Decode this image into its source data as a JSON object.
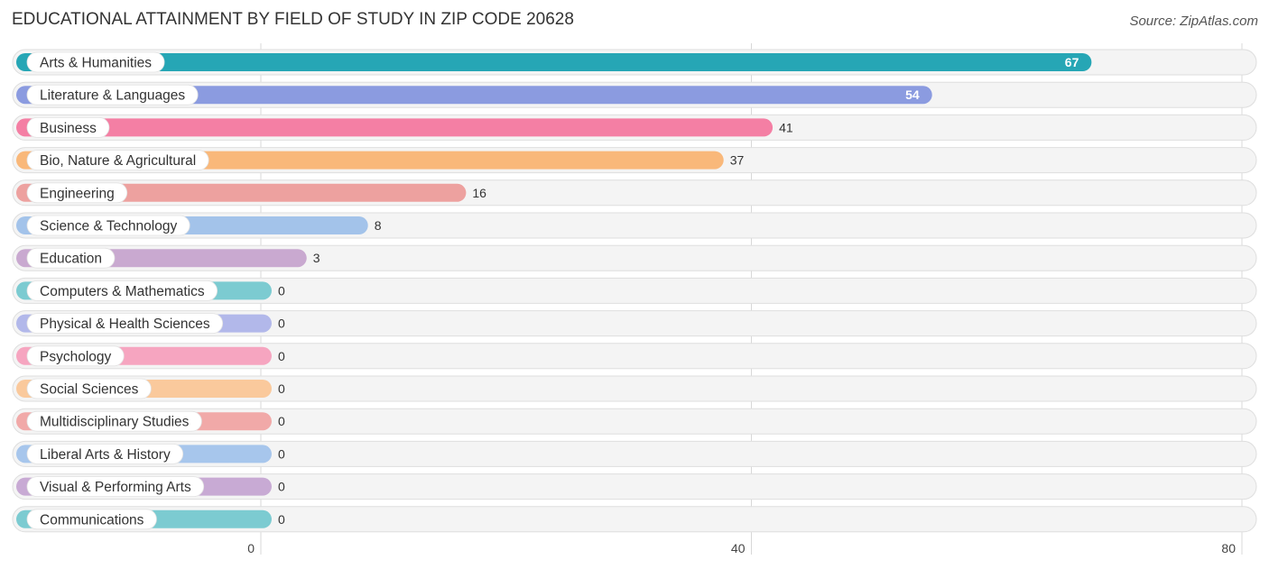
{
  "header": {
    "title": "EDUCATIONAL ATTAINMENT BY FIELD OF STUDY IN ZIP CODE 20628",
    "source": "Source: ZipAtlas.com"
  },
  "chart_data": {
    "type": "bar",
    "orientation": "horizontal",
    "title": "EDUCATIONAL ATTAINMENT BY FIELD OF STUDY IN ZIP CODE 20628",
    "xlabel": "",
    "ylabel": "",
    "xlim": [
      0,
      80
    ],
    "grid": true,
    "x_ticks": [
      0,
      40,
      80
    ],
    "x_tick_labels": [
      "0",
      "40",
      "80"
    ],
    "categories": [
      "Arts & Humanities",
      "Literature & Languages",
      "Business",
      "Bio, Nature & Agricultural",
      "Engineering",
      "Science & Technology",
      "Education",
      "Computers & Mathematics",
      "Physical & Health Sciences",
      "Psychology",
      "Social Sciences",
      "Multidisciplinary Studies",
      "Liberal Arts & History",
      "Visual & Performing Arts",
      "Communications"
    ],
    "values": [
      67,
      54,
      41,
      37,
      16,
      8,
      3,
      0,
      0,
      0,
      0,
      0,
      0,
      0,
      0
    ],
    "value_labels": [
      "67",
      "54",
      "41",
      "37",
      "16",
      "8",
      "3",
      "0",
      "0",
      "0",
      "0",
      "0",
      "0",
      "0",
      "0"
    ],
    "colors": [
      "#26a6b5",
      "#8b9be0",
      "#f47fa4",
      "#f9b87a",
      "#eda19f",
      "#a3c3ea",
      "#c9a9d0",
      "#7ccbd1",
      "#b2b8ea",
      "#f6a5c0",
      "#fac99c",
      "#f1a9a8",
      "#a7c6ec",
      "#c8aad4",
      "#7ccbd1"
    ]
  }
}
